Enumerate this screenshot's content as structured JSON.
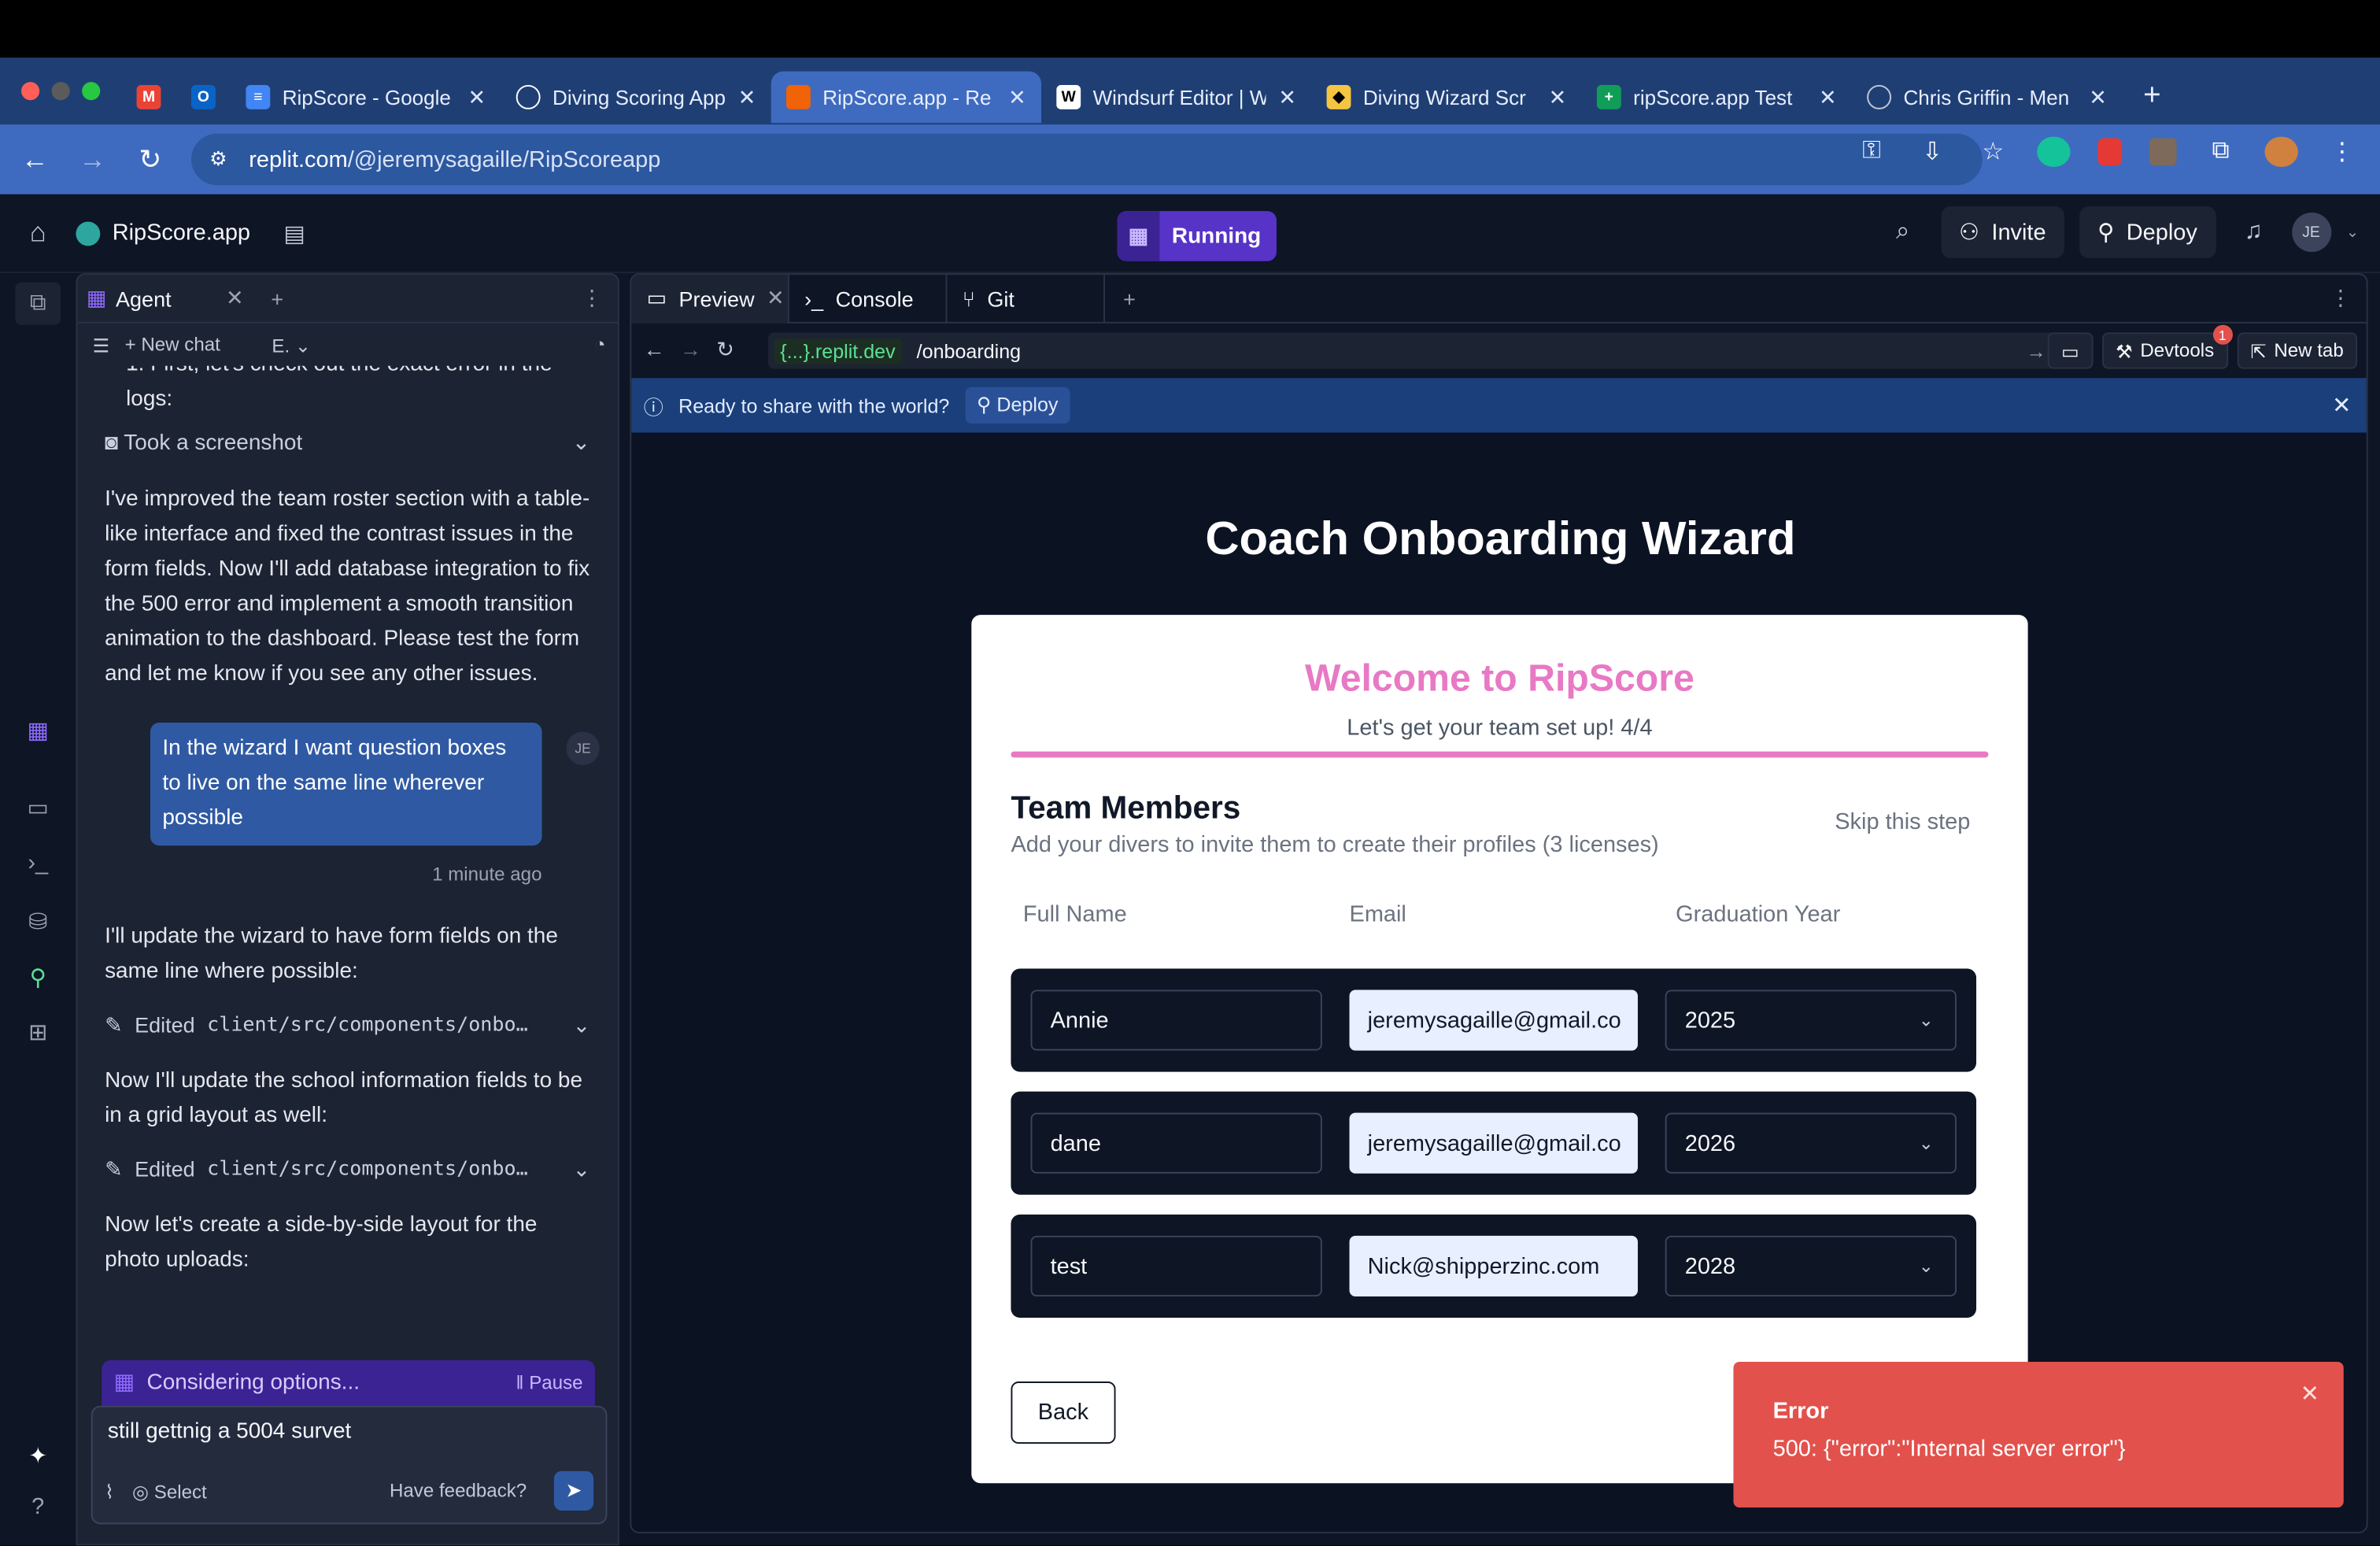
{
  "browser": {
    "tabs": [
      {
        "icon": "gmail-icon",
        "label": "",
        "color": "#ea4335"
      },
      {
        "icon": "outlook-icon",
        "label": "",
        "color": "#0a64c8"
      },
      {
        "icon": "docs-icon",
        "label": "RipScore - Google",
        "color": "#4285f4"
      },
      {
        "icon": "chatgpt-icon",
        "label": "Diving Scoring App",
        "color": "#ffffff"
      },
      {
        "icon": "replit-icon",
        "label": "RipScore.app - Re",
        "color": "#f26207",
        "active": true
      },
      {
        "icon": "windsurf-icon",
        "label": "Windsurf Editor | W",
        "color": "#ffffff"
      },
      {
        "icon": "claude-icon",
        "label": "Diving Wizard Scr",
        "color": "#f5c542"
      },
      {
        "icon": "sheets-icon",
        "label": "ripScore.app Test",
        "color": "#0f9d58"
      },
      {
        "icon": "globe-icon",
        "label": "Chris Griffin - Men",
        "color": "#c2c8d4"
      }
    ],
    "url_host": "replit.com",
    "url_path": "/@jeremysagaille/RipScoreapp"
  },
  "header": {
    "app_name": "RipScore.app",
    "running_label": "Running",
    "invite_label": "Invite",
    "deploy_label": "Deploy",
    "avatar_initials": "JE"
  },
  "agent": {
    "tab_label": "Agent",
    "new_chat_label": "New chat",
    "model_label": "E.",
    "partial_top": "1. First, let's check out the exact error in the",
    "partial_top2": "logs:",
    "screenshot_label": "Took a screenshot",
    "msg1": "I've improved the team roster section with a table-like interface and fixed the contrast issues in the form fields. Now I'll add database integration to fix the 500 error and implement a smooth transition animation to the dashboard. Please test the form and let me know if you see any other issues.",
    "user_msg": "In the wizard I want question boxes to live on the same line wherever possible",
    "user_initials": "JE",
    "user_time": "1 minute ago",
    "msg2": "I'll update the wizard to have form fields on the same line where possible:",
    "edit1_label": "Edited",
    "edit1_path": "client/src/components/onbo…",
    "msg3": "Now I'll update the school information fields to be in a grid layout as well:",
    "edit2_label": "Edited",
    "edit2_path": "client/src/components/onbo…",
    "msg4": "Now let's create a side-by-side layout for the photo uploads:",
    "considering_label": "Considering options...",
    "pause_label": "Pause",
    "composer_text": "still gettnig a 5004 survet",
    "select_label": "Select",
    "feedback_label": "Have feedback?"
  },
  "preview": {
    "tabs": [
      "Preview",
      "Console",
      "Git"
    ],
    "host": "{...}.replit.dev",
    "path": "/onboarding",
    "devtools_label": "Devtools",
    "devtools_badge": "1",
    "newtab_label": "New tab",
    "share_text": "Ready to share with the world?",
    "share_deploy": "Deploy"
  },
  "wizard": {
    "page_title": "Coach Onboarding Wizard",
    "welcome": "Welcome to RipScore",
    "subtitle": "Let's get your team set up! 4/4",
    "section_title": "Team Members",
    "section_sub": "Add your divers to invite them to create their profiles (3 licenses)",
    "skip_label": "Skip this step",
    "col_name": "Full Name",
    "col_email": "Email",
    "col_year": "Graduation Year",
    "members": [
      {
        "name": "Annie",
        "email": "jeremysagaille@gmail.co",
        "year": "2025"
      },
      {
        "name": "dane",
        "email": "jeremysagaille@gmail.co",
        "year": "2026"
      },
      {
        "name": "test",
        "email": "Nick@shipperzinc.com",
        "year": "2028"
      }
    ],
    "back_label": "Back",
    "progress_fraction": 1.0
  },
  "toast": {
    "title": "Error",
    "message": "500: {\"error\":\"Internal server error\"}"
  },
  "colors": {
    "accent_pink": "#e879c4",
    "running_purple": "#5733c8",
    "error_red": "#e2514c",
    "chrome_blue": "#3e6bbf"
  }
}
